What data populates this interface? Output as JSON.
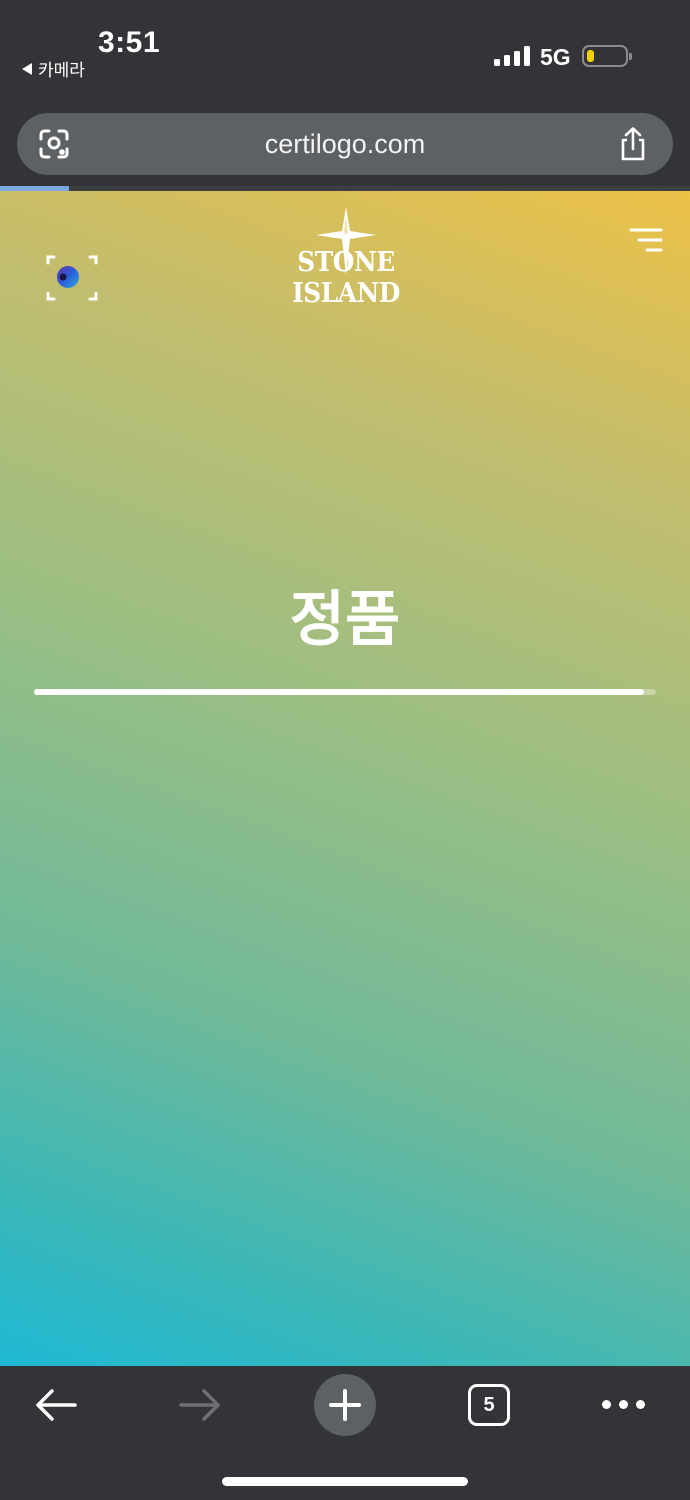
{
  "status_bar": {
    "time": "3:51",
    "back_app": "카메라",
    "network": "5G",
    "battery_level": 0.18,
    "battery_color": "#f5d400"
  },
  "browser": {
    "url": "certilogo.com",
    "load_progress": 0.1,
    "lens_icon": "lens-icon",
    "share_icon": "share-icon"
  },
  "page": {
    "brand": "STONE ISLAND",
    "verdict": "정품",
    "result_progress": 0.98,
    "gradient_top": "#ecc147",
    "gradient_bottom": "#1fb8d4",
    "icons": [
      "scan-icon",
      "menu-icon"
    ]
  },
  "toolbar": {
    "tab_count": "5",
    "icons": [
      "back-arrow-icon",
      "forward-arrow-icon",
      "plus-icon",
      "tabs-icon",
      "more-icon"
    ]
  }
}
